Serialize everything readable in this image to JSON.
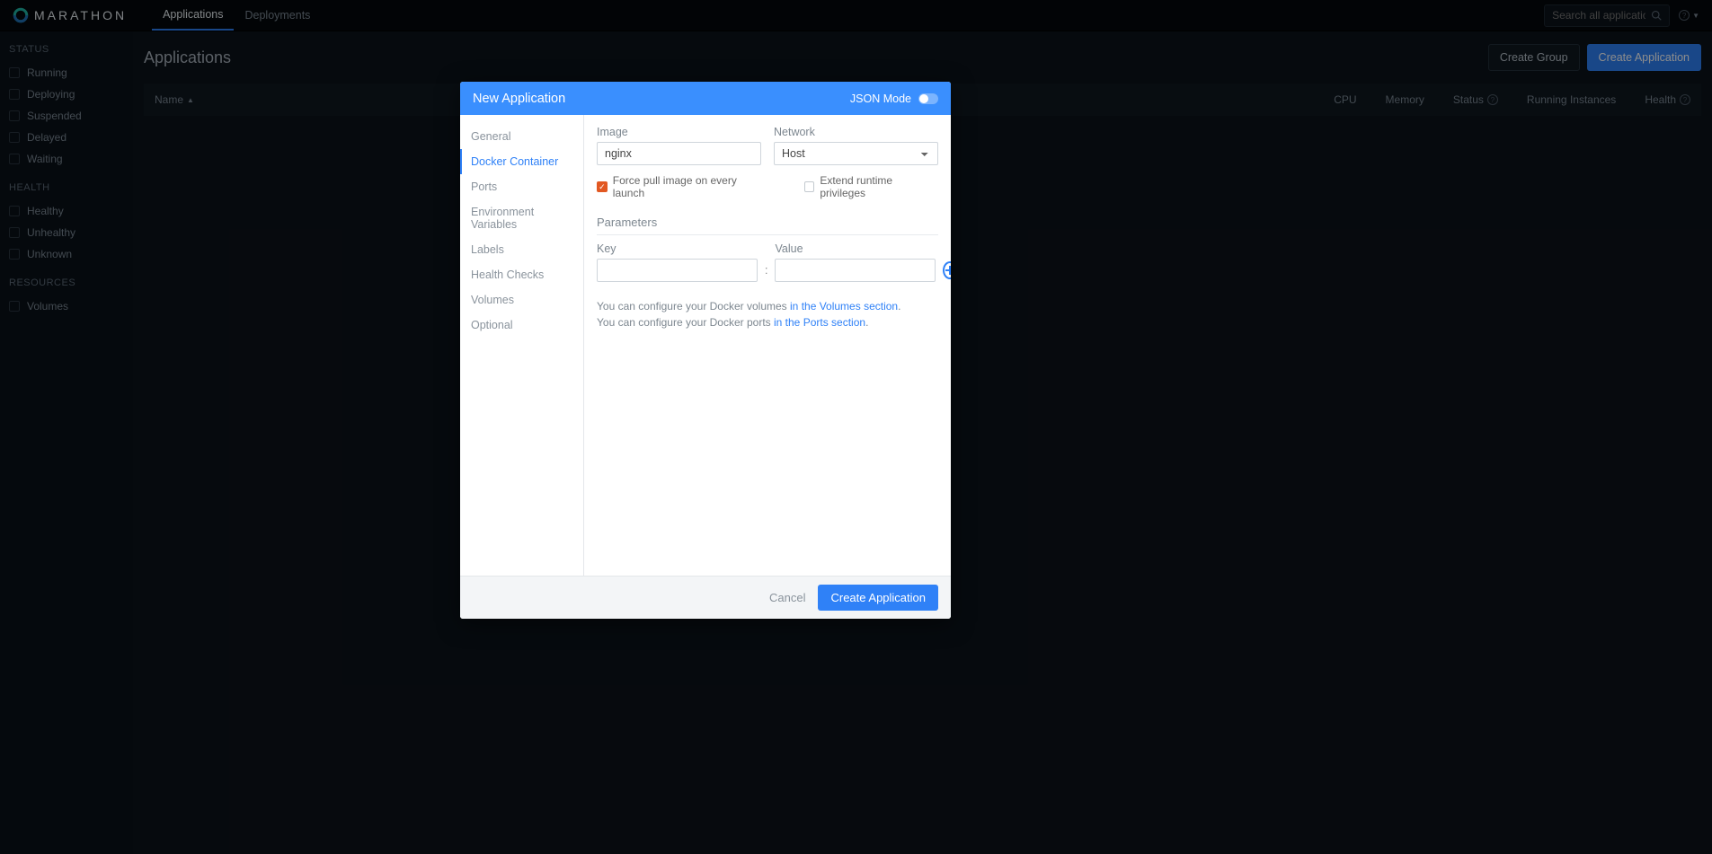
{
  "brand": "MARATHON",
  "nav": {
    "tabs": [
      "Applications",
      "Deployments"
    ],
    "active": 0
  },
  "search": {
    "placeholder": "Search all applications"
  },
  "sidebar": {
    "status": {
      "header": "STATUS",
      "items": [
        "Running",
        "Deploying",
        "Suspended",
        "Delayed",
        "Waiting"
      ]
    },
    "health": {
      "header": "HEALTH",
      "items": [
        "Healthy",
        "Unhealthy",
        "Unknown"
      ]
    },
    "resources": {
      "header": "RESOURCES",
      "items": [
        "Volumes"
      ]
    }
  },
  "page": {
    "title": "Applications",
    "create_group": "Create Group",
    "create_app": "Create Application"
  },
  "table": {
    "cols": {
      "name": "Name",
      "cpu": "CPU",
      "memory": "Memory",
      "status": "Status",
      "running": "Running Instances",
      "health": "Health"
    }
  },
  "modal": {
    "title": "New Application",
    "json_mode": "JSON Mode",
    "nav": [
      "General",
      "Docker Container",
      "Ports",
      "Environment Variables",
      "Labels",
      "Health Checks",
      "Volumes",
      "Optional"
    ],
    "nav_active": 1,
    "form": {
      "image": {
        "label": "Image",
        "value": "nginx"
      },
      "network": {
        "label": "Network",
        "value": "Host"
      },
      "force_pull_label": "Force pull image on every launch",
      "force_pull_checked": true,
      "extend_priv_label": "Extend runtime privileges",
      "extend_priv_checked": false,
      "parameters_title": "Parameters",
      "key_label": "Key",
      "value_label": "Value",
      "hint_vol_pre": "You can configure your Docker volumes ",
      "hint_vol_link": "in the Volumes section",
      "hint_port_pre": "You can configure your Docker ports ",
      "hint_port_link": "in the Ports section"
    },
    "footer": {
      "cancel": "Cancel",
      "create": "Create Application"
    }
  }
}
